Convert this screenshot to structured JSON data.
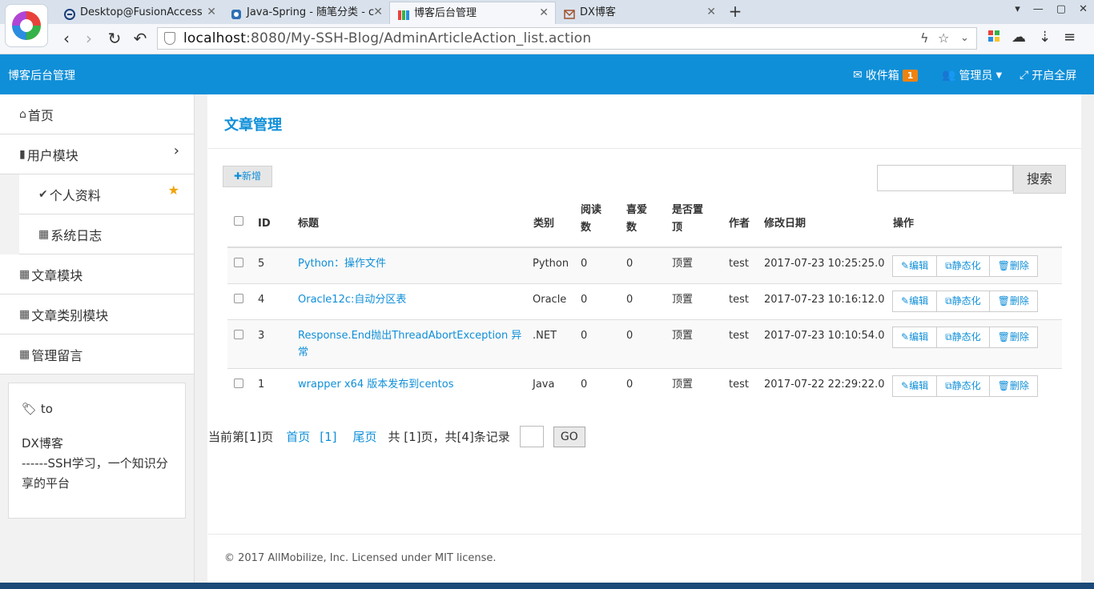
{
  "browser": {
    "tabs": [
      {
        "label": "Desktop@FusionAccess",
        "active": false,
        "icon": "fusion-icon"
      },
      {
        "label": "Java-Spring - 随笔分类 - c",
        "active": false,
        "icon": "cnblogs-icon"
      },
      {
        "label": "博客后台管理",
        "active": true,
        "icon": "admin-icon"
      },
      {
        "label": "DX博客",
        "active": false,
        "icon": "dx-icon"
      }
    ],
    "new_tab": "+",
    "url_host": "localhost",
    "url_rest": ":8080/My-SSH-Blog/AdminArticleAction_list.action"
  },
  "header": {
    "brand": "博客后台管理",
    "inbox_label": "收件箱",
    "inbox_count": "1",
    "admin_label": "管理员",
    "fullscreen_label": "开启全屏",
    "accent": "#0f8fd8",
    "badge_color": "#f0830f"
  },
  "sidebar": {
    "items": [
      {
        "label": "首页",
        "icon": "home-icon"
      },
      {
        "label": "用户模块",
        "icon": "file-icon",
        "expand": "›"
      },
      {
        "label": "个人资料",
        "icon": "check-icon"
      },
      {
        "label": "系统日志",
        "icon": "calendar-icon"
      },
      {
        "label": "文章模块",
        "icon": "table-icon"
      },
      {
        "label": "文章类别模块",
        "icon": "table-icon"
      },
      {
        "label": "管理留言",
        "icon": "table-icon"
      }
    ],
    "box": {
      "tag": "to",
      "line1": "DX博客",
      "line2": "------SSH学习，一个知识分享的平台"
    }
  },
  "main": {
    "title": "文章管理",
    "add_label": "新增",
    "search_label": "搜索",
    "search_value": "",
    "columns": {
      "id": "ID",
      "title": "标题",
      "category": "类别",
      "reads": "阅读数",
      "likes": "喜爱数",
      "top": "是否置顶",
      "author": "作者",
      "modified": "修改日期",
      "actions": "操作"
    },
    "rows": [
      {
        "id": "5",
        "title": "Python：操作文件",
        "category": "Python",
        "reads": "0",
        "likes": "0",
        "top": "顶置",
        "author": "test",
        "modified": "2017-07-23 10:25:25.0"
      },
      {
        "id": "4",
        "title": "Oracle12c:自动分区表",
        "category": "Oracle",
        "reads": "0",
        "likes": "0",
        "top": "顶置",
        "author": "test",
        "modified": "2017-07-23 10:16:12.0"
      },
      {
        "id": "3",
        "title": "Response.End抛出ThreadAbortException 异常",
        "category": ".NET",
        "reads": "0",
        "likes": "0",
        "top": "顶置",
        "author": "test",
        "modified": "2017-07-23 10:10:54.0"
      },
      {
        "id": "1",
        "title": "wrapper x64 版本发布到centos",
        "category": "Java",
        "reads": "0",
        "likes": "0",
        "top": "顶置",
        "author": "test",
        "modified": "2017-07-22 22:29:22.0"
      }
    ],
    "actions": {
      "edit": "编辑",
      "static": "静态化",
      "delete": "删除"
    },
    "pager": {
      "current": "当前第[1]页",
      "first": "首页",
      "page1": "[1]",
      "last": "尾页",
      "summary": "共 [1]页，共[4]条记录",
      "go_label": "GO"
    },
    "footer": "© 2017 AllMobilize, Inc. Licensed under MIT license."
  }
}
